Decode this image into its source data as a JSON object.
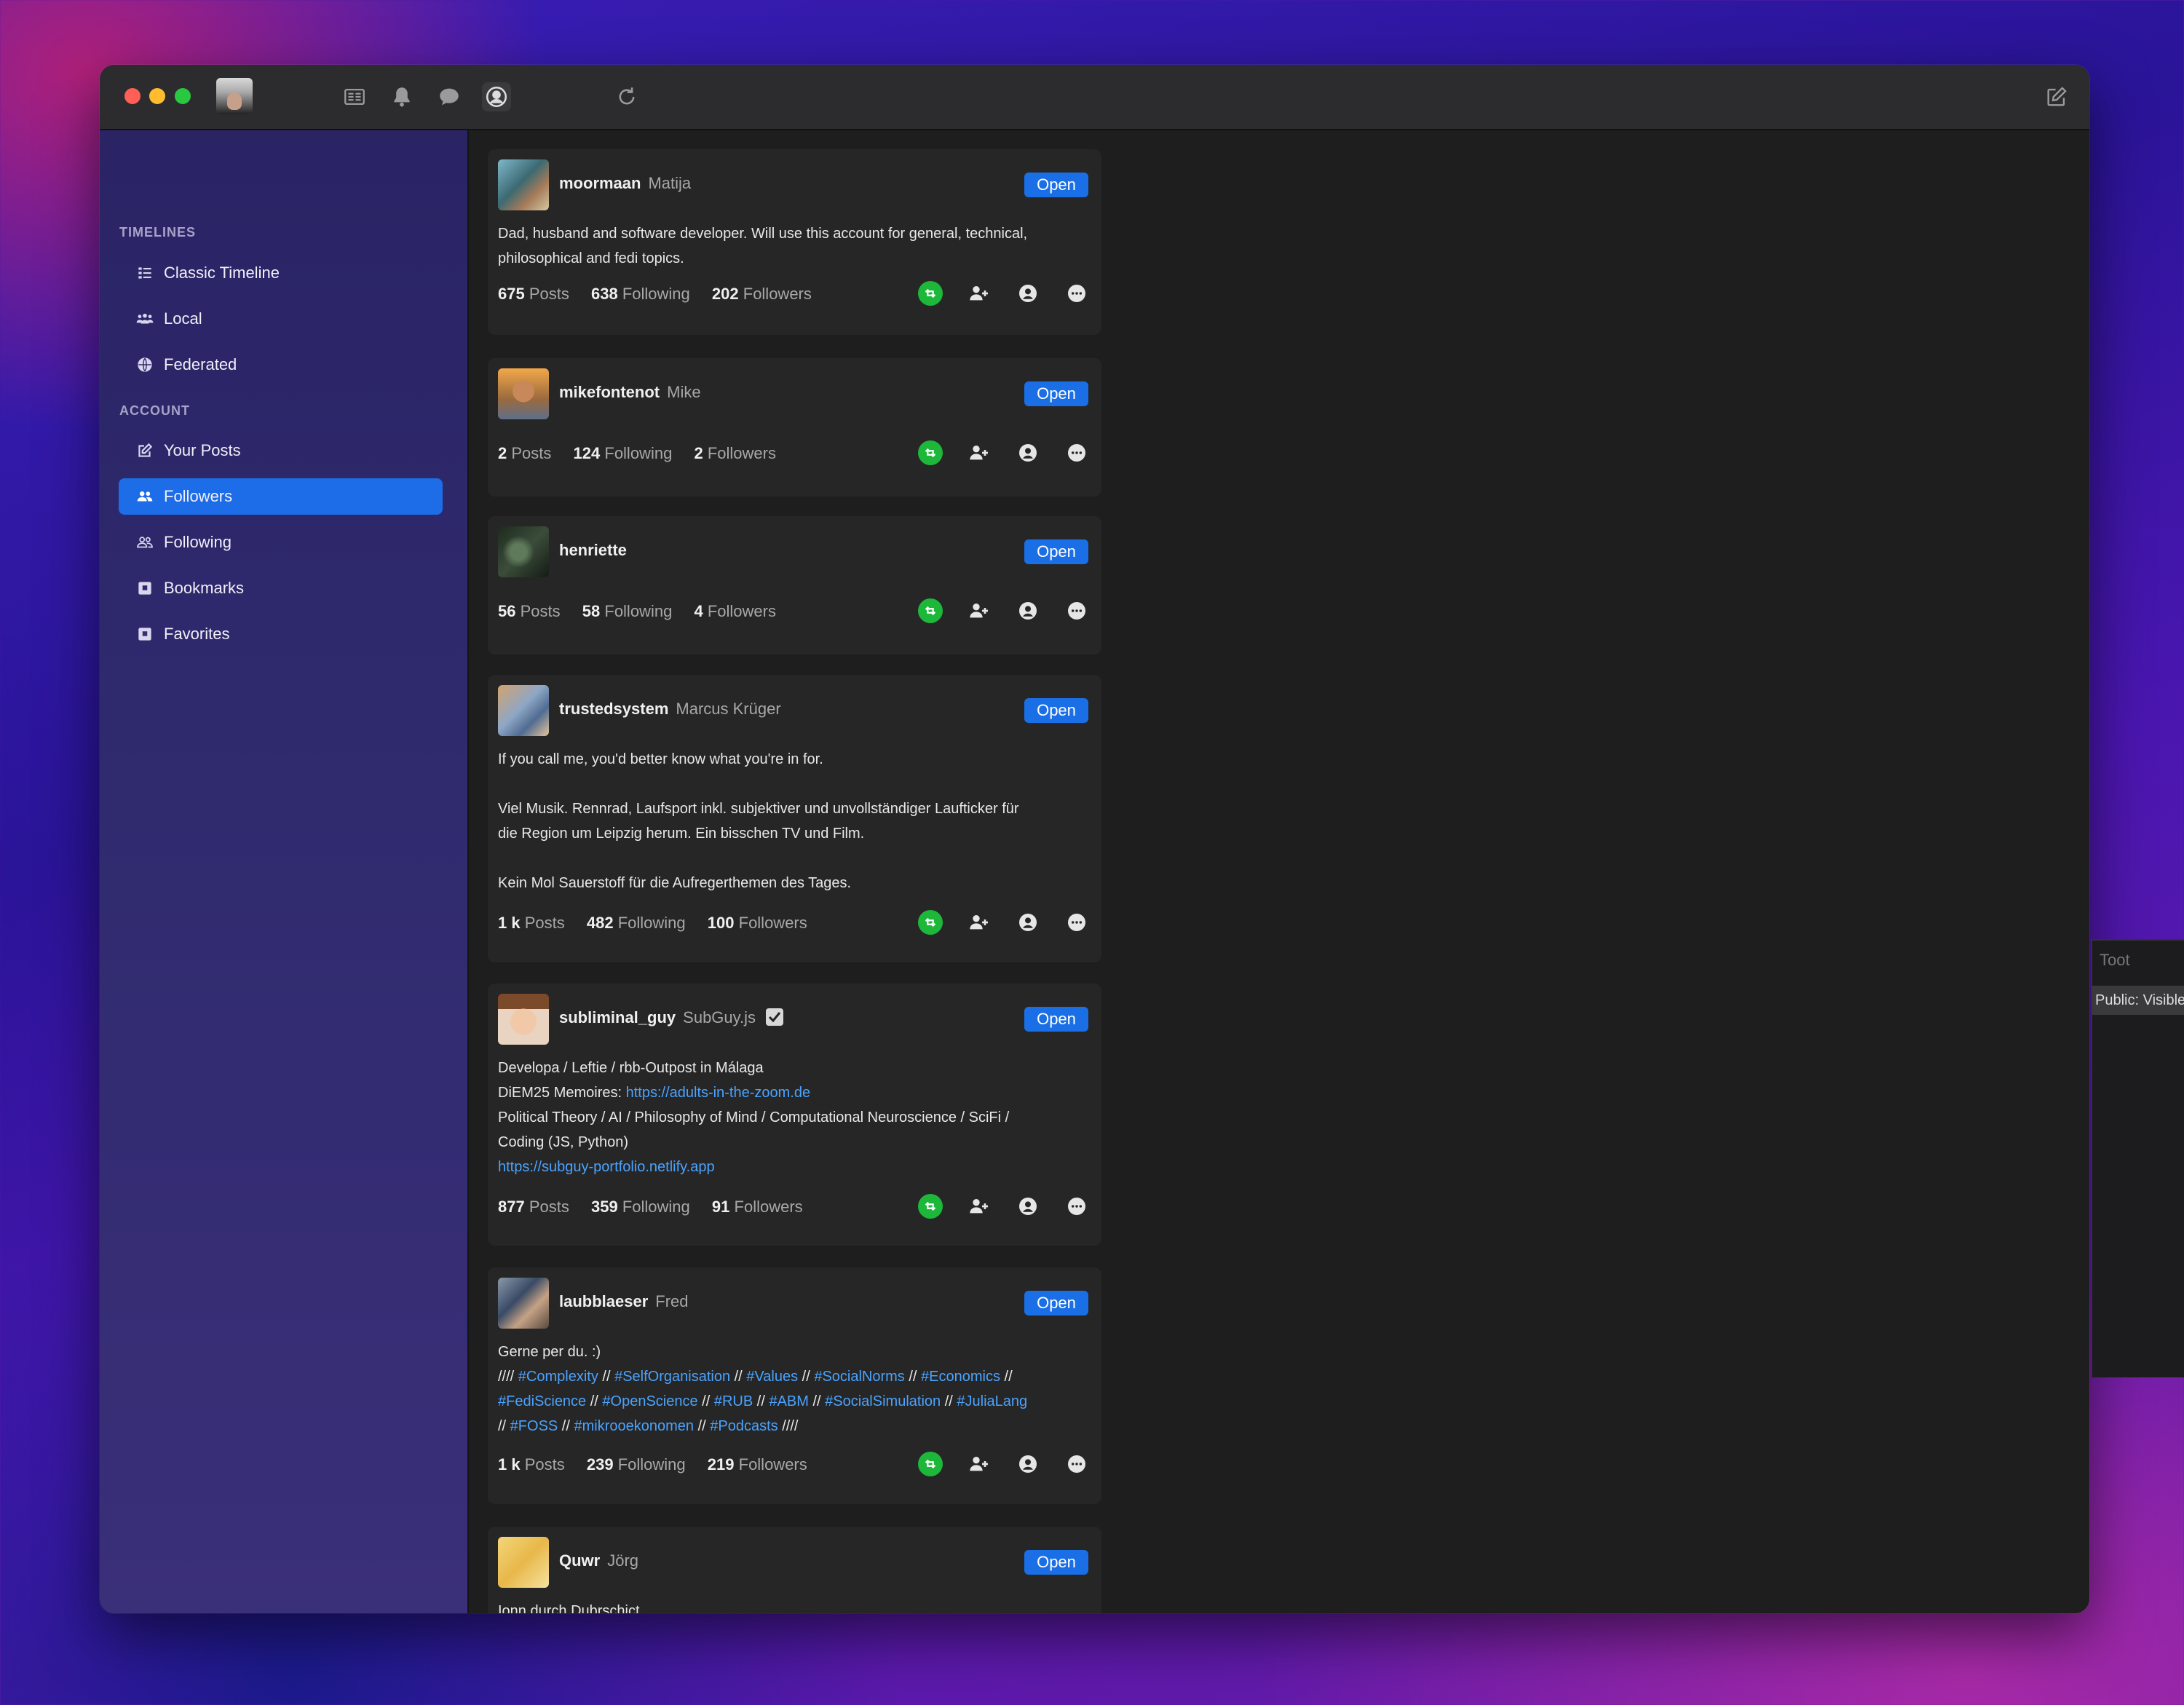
{
  "sidebar": {
    "timelines_label": "TIMELINES",
    "account_label": "ACCOUNT",
    "items": [
      {
        "label": "Classic Timeline",
        "icon": "list-icon"
      },
      {
        "label": "Local",
        "icon": "people-group-icon"
      },
      {
        "label": "Federated",
        "icon": "globe-icon"
      },
      {
        "label": "Your Posts",
        "icon": "compose-icon"
      },
      {
        "label": "Followers",
        "icon": "people-icon",
        "selected": true
      },
      {
        "label": "Following",
        "icon": "people-outline-icon"
      },
      {
        "label": "Bookmarks",
        "icon": "bookmark-icon"
      },
      {
        "label": "Favorites",
        "icon": "star-icon"
      }
    ]
  },
  "toolbar": {
    "icons": [
      "timeline-icon",
      "bell-icon",
      "chat-bubble-icon",
      "account-circle-icon",
      "refresh-icon",
      "compose-icon"
    ]
  },
  "cards": [
    {
      "username": "moormaan",
      "display_name": "Matija",
      "open_label": "Open",
      "bio": [
        "Dad, husband and software developer. Will use this account for general, technical,",
        "philosophical and fedi topics."
      ],
      "posts": "675",
      "posts_label": "Posts",
      "following": "638",
      "following_label": "Following",
      "followers": "202",
      "followers_label": "Followers"
    },
    {
      "username": "mikefontenot",
      "display_name": "Mike",
      "open_label": "Open",
      "posts": "2",
      "posts_label": "Posts",
      "following": "124",
      "following_label": "Following",
      "followers": "2",
      "followers_label": "Followers"
    },
    {
      "username": "henriette",
      "display_name": "",
      "open_label": "Open",
      "posts": "56",
      "posts_label": "Posts",
      "following": "58",
      "following_label": "Following",
      "followers": "4",
      "followers_label": "Followers"
    },
    {
      "username": "trustedsystem",
      "display_name": "Marcus Krüger",
      "open_label": "Open",
      "bio": [
        "If you call me, you'd better know what you're in for.",
        "Viel Musik. Rennrad, Laufsport inkl. subjektiver und unvollständiger Laufticker für",
        "die Region um Leipzig herum. Ein bisschen TV und Film.",
        "Kein Mol Sauerstoff für die Aufregerthemen des Tages."
      ],
      "posts": "1 k",
      "posts_label": "Posts",
      "following": "482",
      "following_label": "Following",
      "followers": "100",
      "followers_label": "Followers"
    },
    {
      "username": "subliminal_guy",
      "display_name": "SubGuy.js",
      "open_label": "Open",
      "bio": [
        "Developa / Leftie / rbb-Outpost in Málaga",
        "DiEM25 Memoires: ",
        "https://adults-in-the-zoom.de",
        "Political Theory / AI / Philosophy of Mind / Computational Neuroscience / SciFi /",
        "Coding (JS, Python)",
        "https://subguy-portfolio.netlify.app"
      ],
      "posts": "877",
      "posts_label": "Posts",
      "following": "359",
      "following_label": "Following",
      "followers": "91",
      "followers_label": "Followers"
    },
    {
      "username": "laubblaeser",
      "display_name": "Fred",
      "open_label": "Open",
      "bio_intro": "Gerne per du. :)",
      "tags": [
        "#Complexity",
        "#SelfOrganisation",
        "#Values",
        "#SocialNorms",
        "#Economics",
        "#FediScience",
        "#OpenScience",
        "#RUB",
        "#ABM",
        "#SocialSimulation",
        "#JuliaLang",
        "#FOSS",
        "#mikrooekonomen",
        "#Podcasts"
      ],
      "separators": [
        "////",
        "//",
        "////"
      ],
      "posts": "1 k",
      "posts_label": "Posts",
      "following": "239",
      "following_label": "Following",
      "followers": "219",
      "followers_label": "Followers"
    },
    {
      "username": "Quwr",
      "display_name": "Jörg",
      "open_label": "Open",
      "bio": [
        "Ionn durch Dubrschict"
      ]
    }
  ],
  "side_panel": {
    "title": "Toot",
    "visibility": "Public: Visible to all"
  }
}
